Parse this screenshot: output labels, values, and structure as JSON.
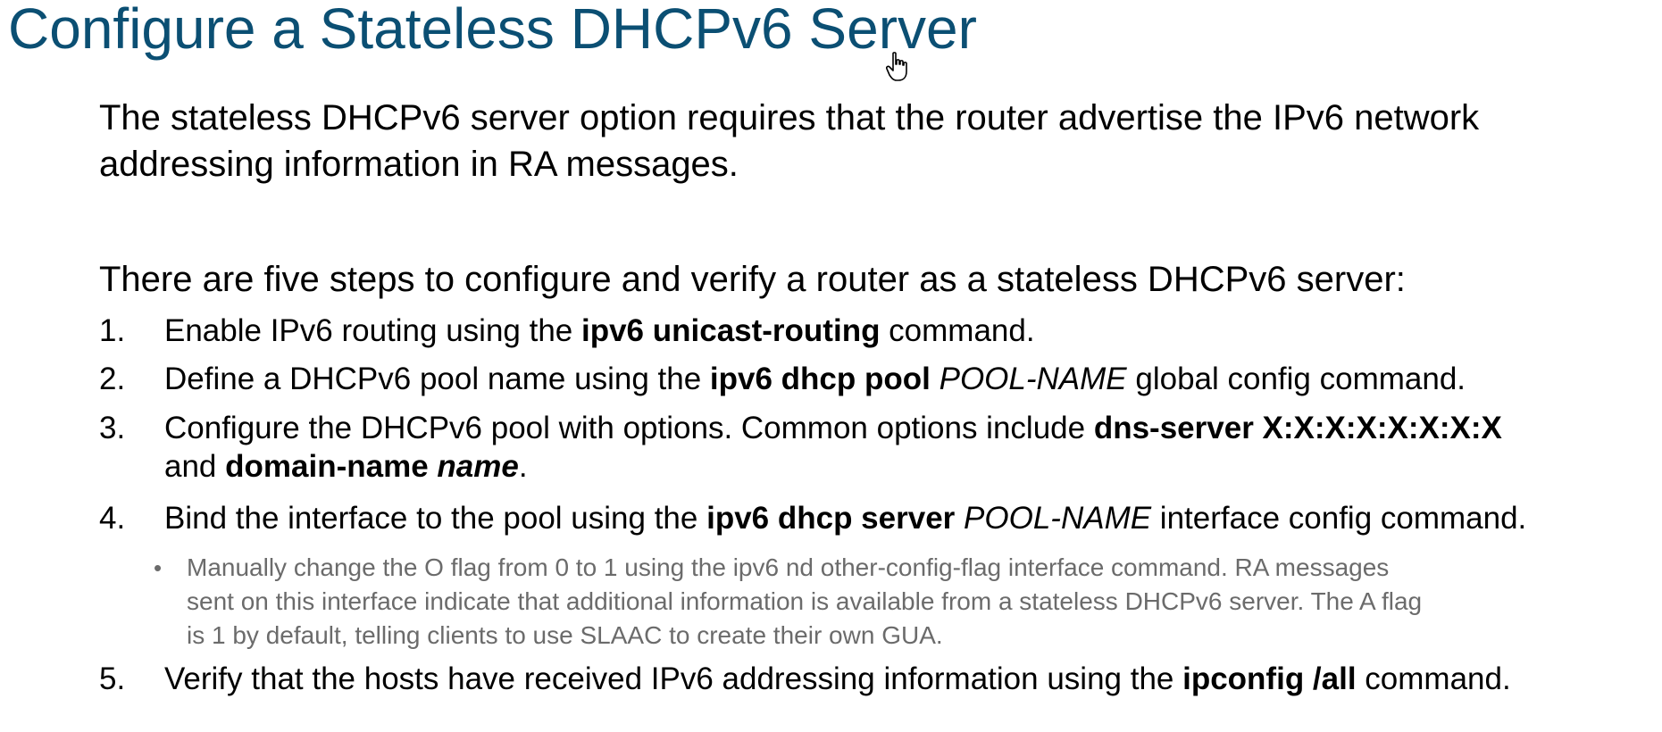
{
  "title": "Configure a Stateless DHCPv6 Server",
  "intro": "The stateless DHCPv6 server option requires that the router advertise the IPv6 network addressing information in RA messages.",
  "steps_intro": "There are five steps to configure and verify a router as a stateless DHCPv6 server:",
  "steps": [
    {
      "num": "1.",
      "pre": "Enable IPv6 routing using the ",
      "cmd": "ipv6 unicast-routing",
      "post": " command."
    },
    {
      "num": "2.",
      "pre": "Define a DHCPv6 pool name using the ",
      "cmd": "ipv6 dhcp pool",
      "arg": "POOL-NAME",
      "post": " global config command."
    },
    {
      "num": "3.",
      "pre": "Configure the DHCPv6 pool with options. Common options include ",
      "cmd": "dns-server X:X:X:X:X:X:X:X",
      "line2_pre": "and ",
      "cmd2": "domain-name",
      "arg2": "name",
      "post": "."
    },
    {
      "num": "4.",
      "pre": "Bind the interface to the pool using the ",
      "cmd": "ipv6 dhcp server",
      "arg": "POOL-NAME",
      "post": " interface config command.",
      "sub": {
        "bullet": "•",
        "lines": [
          "Manually change the O flag from 0 to 1 using the ipv6 nd other-config-flag interface command. RA messages",
          "sent on this interface indicate that additional information is available from a stateless DHCPv6 server. The A flag",
          "is 1 by default, telling clients to use SLAAC to create their own GUA."
        ]
      }
    },
    {
      "num": "5.",
      "pre": "Verify that the hosts have received IPv6 addressing information using the ",
      "cmd": "ipconfig /all",
      "post": " command."
    }
  ],
  "colors": {
    "title": "#0b4f73",
    "text": "#000000",
    "subtext": "#6b6b6b"
  },
  "icons": {
    "cursor": "hand-pointer-icon"
  }
}
